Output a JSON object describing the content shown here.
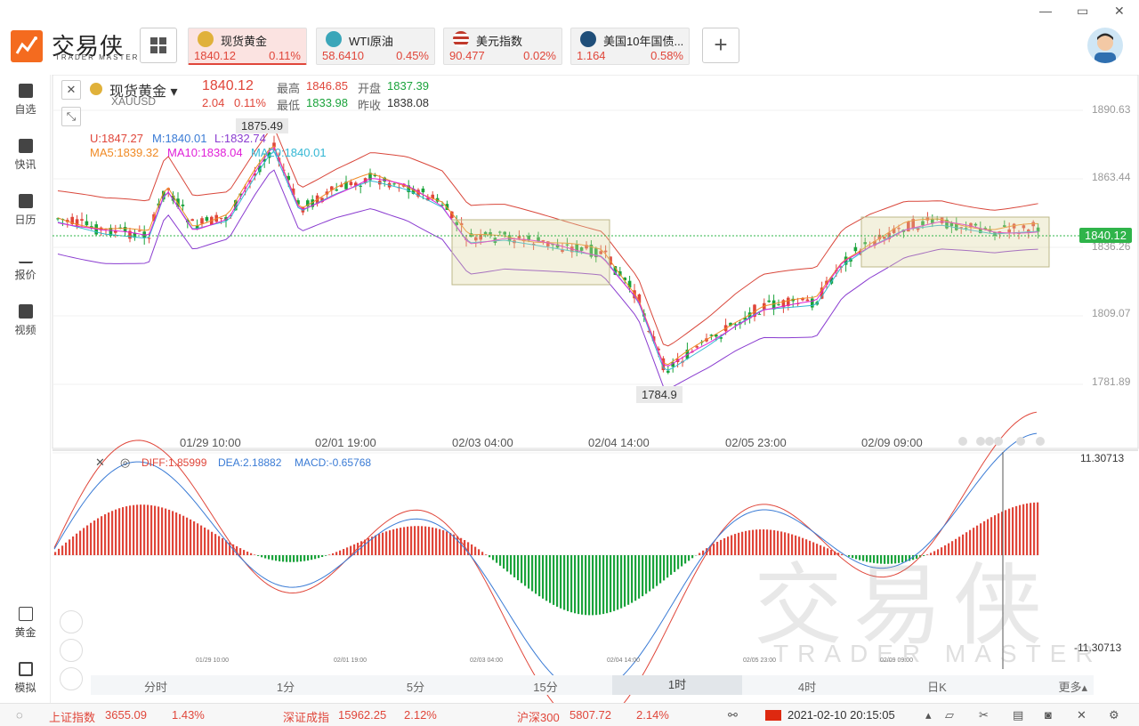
{
  "window": {
    "min": "—",
    "restore": "▭",
    "close": "✕"
  },
  "brand": {
    "name": "交易侠",
    "sub": "TRADER MASTER"
  },
  "quote_tabs": [
    {
      "name": "现货黄金",
      "price": "1840.12",
      "pct": "0.11%",
      "icon_color": "#e0b13a"
    },
    {
      "name": "WTI原油",
      "price": "58.6410",
      "pct": "0.45%",
      "icon_color": "#3aa6b9"
    },
    {
      "name": "美元指数",
      "price": "90.477",
      "pct": "0.02%",
      "icon_color": "#c0392b"
    },
    {
      "name": "美国10年国债...",
      "price": "1.164",
      "pct": "0.58%",
      "icon_color": "#1f4e79"
    }
  ],
  "add_label": "+",
  "sidebar": [
    {
      "label": "自选",
      "icon": "star-plus-icon"
    },
    {
      "label": "快讯",
      "icon": "news-icon"
    },
    {
      "label": "日历",
      "icon": "calendar-icon"
    },
    {
      "label": "报价",
      "icon": "quote-icon"
    },
    {
      "label": "视频",
      "icon": "video-icon"
    },
    {
      "label": "黄金",
      "icon": "sge-icon"
    },
    {
      "label": "模拟",
      "icon": "wallet-icon"
    }
  ],
  "header": {
    "symbol_name": "现货黄金",
    "symbol_code": "XAUUSD",
    "price": "1840.12",
    "change": "2.04",
    "change_pct": "0.11%",
    "high_label": "最高",
    "high": "1846.85",
    "open_label": "开盘",
    "open": "1837.39",
    "low_label": "最低",
    "low": "1833.98",
    "prev_label": "昨收",
    "prev": "1838.08"
  },
  "boll": {
    "u": "U:1847.27",
    "m": "M:1840.01",
    "l": "L:1832.74"
  },
  "ma": {
    "ma5": "MA5:1839.32",
    "ma10": "MA10:1838.04",
    "ma20": "MA20:1840.01"
  },
  "annot": {
    "high": "1875.49",
    "low": "1784.9"
  },
  "yaxis": [
    "1890.63",
    "1863.44",
    "1836.26",
    "1809.07",
    "1781.89"
  ],
  "current_price_tag": "1840.12",
  "xaxis": [
    "01/29 10:00",
    "02/01 19:00",
    "02/03 04:00",
    "02/04 14:00",
    "02/05 23:00",
    "02/09 09:00"
  ],
  "macd": {
    "diff": "DIFF:1.85999",
    "dea": "DEA:2.18882",
    "macd": "MACD:-0.65768",
    "top": "11.30713",
    "bottom": "-11.30713"
  },
  "macd_xaxis": [
    "01/29 10:00",
    "02/01 19:00",
    "02/03 04:00",
    "02/04 14:00",
    "02/05 23:00",
    "02/09 09:00"
  ],
  "timeframes": [
    "分时",
    "1分",
    "5分",
    "15分",
    "1时",
    "4时",
    "日K",
    "更多▴"
  ],
  "active_tf": "1时",
  "watermark": {
    "cn": "交易侠",
    "en": "TRADER MASTER"
  },
  "status": {
    "sh_label": "上证指数",
    "sh_val": "3655.09",
    "sh_pct": "1.43%",
    "sz_label": "深证成指",
    "sz_val": "15962.25",
    "sz_pct": "2.12%",
    "hs_label": "沪深300",
    "hs_val": "5807.72",
    "hs_pct": "2.14%",
    "datetime": "2021-02-10 20:15:05"
  },
  "colors": {
    "up": "#e0463a",
    "down": "#1aa33b",
    "boll_u": "#d9473b",
    "boll_l": "#8a3cd0",
    "ma5": "#f08a24",
    "ma10": "#e020d8",
    "ma20": "#33b7d4"
  }
}
